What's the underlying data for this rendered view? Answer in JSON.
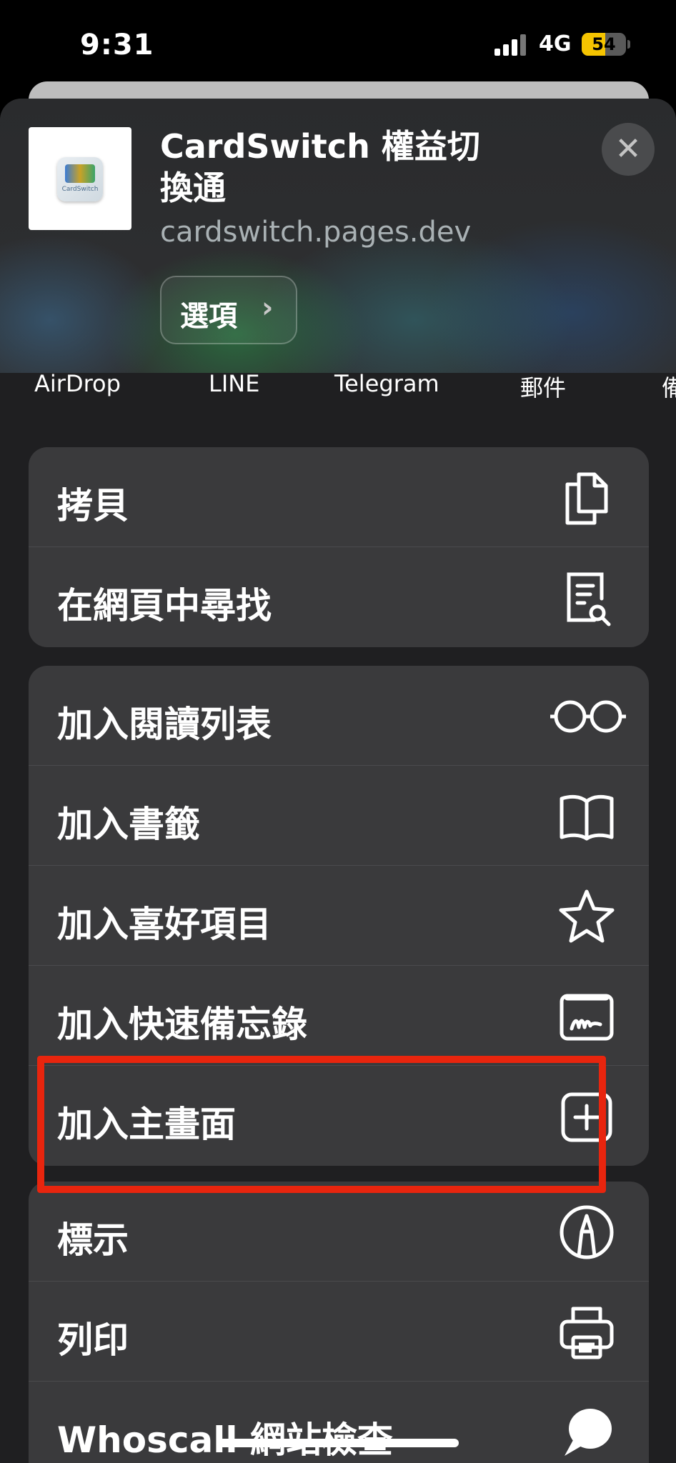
{
  "status_bar": {
    "time": "9:31",
    "network": "4G",
    "battery": "54",
    "battery_level": 0.54
  },
  "header": {
    "icon_text": "CardSwitch",
    "title": "CardSwitch 權益切換通",
    "url": "cardswitch.pages.dev",
    "options_label": "選項",
    "options_chevron": "›",
    "close_glyph": "✕"
  },
  "share_targets": [
    {
      "label": "AirDrop"
    },
    {
      "label": "LINE"
    },
    {
      "label": "Telegram"
    },
    {
      "label": "郵件"
    },
    {
      "label": "備"
    }
  ],
  "group1": [
    {
      "label": "拷貝",
      "icon": "copy-icon"
    },
    {
      "label": "在網頁中尋找",
      "icon": "find-in-page-icon"
    }
  ],
  "group2": [
    {
      "label": "加入閱讀列表",
      "icon": "glasses-icon"
    },
    {
      "label": "加入書籤",
      "icon": "book-icon"
    },
    {
      "label": "加入喜好項目",
      "icon": "star-icon"
    },
    {
      "label": "加入快速備忘錄",
      "icon": "quick-note-icon"
    },
    {
      "label": "加入主畫面",
      "icon": "add-square-icon"
    }
  ],
  "group3": [
    {
      "label": "標示",
      "icon": "markup-icon"
    },
    {
      "label": "列印",
      "icon": "printer-icon"
    },
    {
      "label": "Whoscall 網站檢查",
      "icon": "whoscall-icon"
    }
  ],
  "colors": {
    "highlight": "#e8250e",
    "row_bg": "#3a3a3c",
    "sheet_bg": "#1f1f21"
  }
}
